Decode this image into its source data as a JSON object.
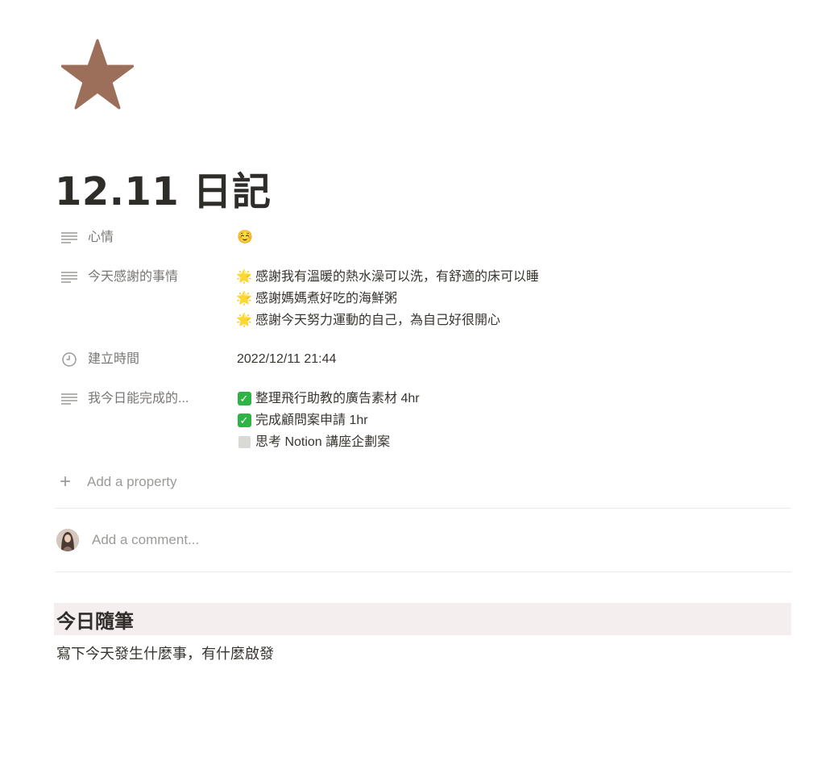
{
  "page": {
    "icon": "star-icon",
    "icon_color": "#9c6f5a",
    "title": "12.11 日記"
  },
  "properties": [
    {
      "icon": "text-lines-icon",
      "name": "心情",
      "values": [
        "☺️"
      ]
    },
    {
      "icon": "text-lines-icon",
      "name": "今天感謝的事情",
      "values": [
        {
          "glyph": "🌟",
          "text": "感謝我有溫暖的熱水澡可以洗，有舒適的床可以睡"
        },
        {
          "glyph": "🌟",
          "text": "感謝媽媽煮好吃的海鮮粥"
        },
        {
          "glyph": "🌟",
          "text": "感謝今天努力運動的自己，為自己好很開心"
        }
      ]
    },
    {
      "icon": "clock-icon",
      "name": "建立時間",
      "values": [
        "2022/12/11 21:44"
      ]
    },
    {
      "icon": "text-lines-icon",
      "name": "我今日能完成的...",
      "values": [
        {
          "checked": true,
          "text": "整理飛行助教的廣告素材 4hr"
        },
        {
          "checked": true,
          "text": "完成顧問案申請 1hr"
        },
        {
          "checked": false,
          "text": "思考 Notion 講座企劃案"
        }
      ]
    }
  ],
  "add_property_label": "Add a property",
  "comment": {
    "placeholder": "Add a comment..."
  },
  "content": {
    "heading": "今日隨筆",
    "body": "寫下今天發生什麼事，有什麼啟發"
  },
  "colors": {
    "heading_bg": "#f4eeee",
    "checkbox_green": "#2fb344"
  }
}
